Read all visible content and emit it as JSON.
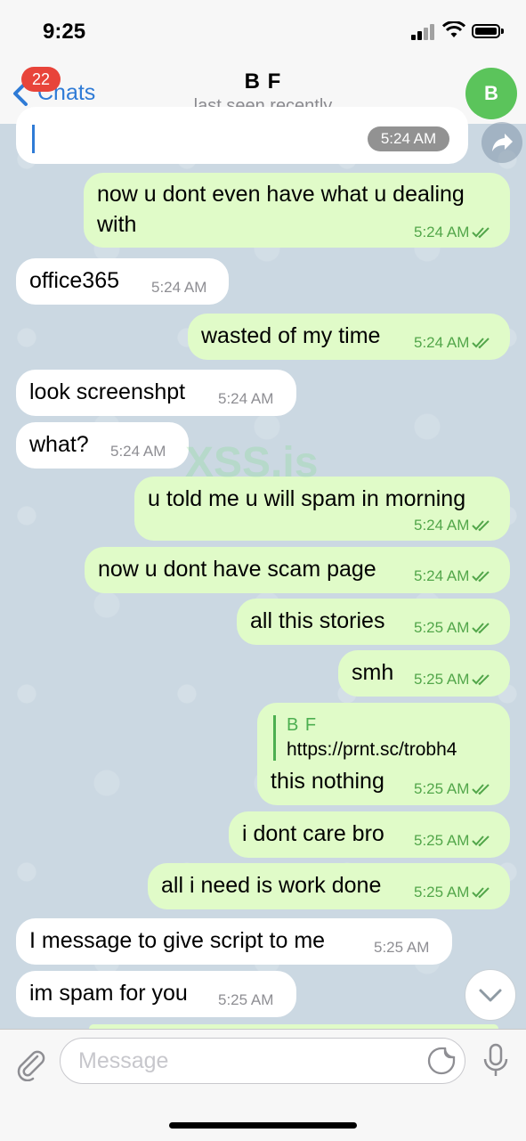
{
  "status_bar": {
    "time": "9:25"
  },
  "nav": {
    "back_label": "Chats",
    "badge": "22",
    "title": "B F",
    "subtitle": "last seen recently",
    "avatar_initial": "B"
  },
  "top_partial": {
    "time": "5:24 AM"
  },
  "messages": [
    {
      "dir": "out",
      "lines": [
        "now u dont even have what u dealing",
        "with"
      ],
      "time": "5:24 AM",
      "read": true
    },
    {
      "dir": "in",
      "text": "office365",
      "time": "5:24 AM"
    },
    {
      "dir": "out",
      "text": "wasted of my time",
      "time": "5:24 AM",
      "read": true
    },
    {
      "dir": "in",
      "text": "look screenshpt",
      "time": "5:24 AM"
    },
    {
      "dir": "in",
      "text": "what?",
      "time": "5:24 AM"
    },
    {
      "dir": "out",
      "text": "u told me u will spam in morning",
      "time": "5:24 AM",
      "read": true
    },
    {
      "dir": "out",
      "text": "now u dont have scam page",
      "time": "5:24 AM",
      "read": true
    },
    {
      "dir": "out",
      "text": "all this stories",
      "time": "5:25 AM",
      "read": true
    },
    {
      "dir": "out",
      "text": "smh",
      "time": "5:25 AM",
      "read": true
    },
    {
      "dir": "out",
      "reply_name": "B F",
      "reply_text": "https://prnt.sc/trobh4",
      "text": "this nothing",
      "time": "5:25 AM",
      "read": true
    },
    {
      "dir": "out",
      "text": "i dont care bro",
      "time": "5:25 AM",
      "read": true
    },
    {
      "dir": "out",
      "text": "all i need is work done",
      "time": "5:25 AM",
      "read": true
    },
    {
      "dir": "in",
      "text": "I  message to give script to me",
      "time": "5:25 AM"
    },
    {
      "dir": "in",
      "text": "im spam for you",
      "time": "5:25 AM"
    }
  ],
  "watermark": "XSS.is",
  "composer": {
    "placeholder": "Message"
  },
  "colors": {
    "accent": "#2f7bd6",
    "outgoing_bubble": "#e0fbc8",
    "incoming_bubble": "#ffffff",
    "badge": "#e8443a",
    "avatar": "#5bc45b"
  }
}
